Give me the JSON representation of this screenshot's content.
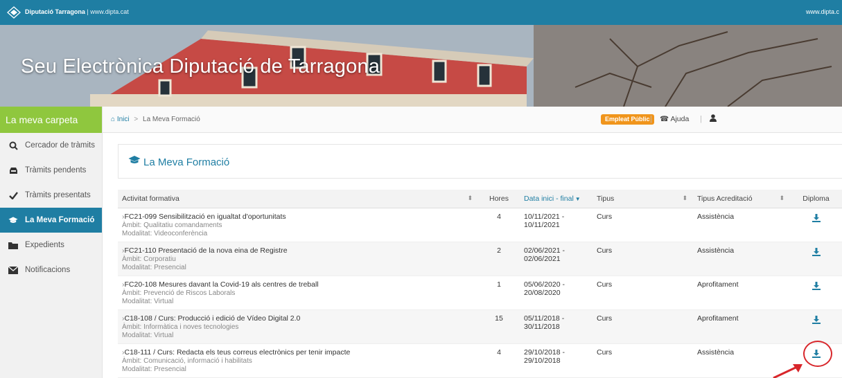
{
  "topbar": {
    "brand": "Diputació Tarragona",
    "brand_url": "| www.dipta.cat",
    "right_url": "www.dipta.c"
  },
  "banner": {
    "title": "Seu Electrònica Diputació de Tarragona"
  },
  "sidebar": {
    "heading": "La meva carpeta",
    "items": [
      {
        "label": "Cercador de tràmits",
        "icon": "search-icon"
      },
      {
        "label": "Tràmits pendents",
        "icon": "inbox-icon"
      },
      {
        "label": "Tràmits presentats",
        "icon": "check-icon"
      },
      {
        "label": "La Meva Formació",
        "icon": "graduation-cap-icon",
        "active": true
      },
      {
        "label": "Expedients",
        "icon": "folder-icon"
      },
      {
        "label": "Notificacions",
        "icon": "envelope-icon"
      }
    ]
  },
  "breadcrumb": {
    "home": "Inici",
    "separator": ">",
    "current": "La Meva Formació"
  },
  "header_actions": {
    "badge": "Empleat Públic",
    "help": "Ajuda"
  },
  "page": {
    "title": "La Meva Formació"
  },
  "table": {
    "columns": [
      "Activitat formativa",
      "Hores",
      "Data inici - final",
      "Tipus",
      "Tipus Acreditació",
      "Diploma"
    ],
    "rows": [
      {
        "title": "FC21-099 Sensibilització en igualtat d'oportunitats",
        "ambit": "Àmbit: Qualitatiu comandaments",
        "modalitat": "Modalitat: Videoconferència",
        "hores": "4",
        "dates": "10/11/2021 - 10/11/2021",
        "tipus": "Curs",
        "acreditacio": "Assistència"
      },
      {
        "title": "FC21-110 Presentació de la nova eina de Registre",
        "ambit": "Àmbit: Corporatiu",
        "modalitat": "Modalitat: Presencial",
        "hores": "2",
        "dates": "02/06/2021 - 02/06/2021",
        "tipus": "Curs",
        "acreditacio": "Assistència"
      },
      {
        "title": "FC20-108 Mesures davant la Covid-19 als centres de treball",
        "ambit": "Àmbit: Prevenció de Riscos Laborals",
        "modalitat": "Modalitat: Virtual",
        "hores": "1",
        "dates": "05/06/2020 - 20/08/2020",
        "tipus": "Curs",
        "acreditacio": "Aprofitament"
      },
      {
        "title": "C18-108 / Curs: Producció i edició de Vídeo Digital 2.0",
        "ambit": "Àmbit: Informàtica i noves tecnologies",
        "modalitat": "Modalitat: Virtual",
        "hores": "15",
        "dates": "05/11/2018 - 30/11/2018",
        "tipus": "Curs",
        "acreditacio": "Aprofitament"
      },
      {
        "title": "C18-111 / Curs: Redacta els teus correus electrònics per tenir impacte",
        "ambit": "Àmbit: Comunicació, informació i habilitats",
        "modalitat": "Modalitat: Presencial",
        "hores": "4",
        "dates": "29/10/2018 - 29/10/2018",
        "tipus": "Curs",
        "acreditacio": "Assistència"
      }
    ]
  },
  "colors": {
    "primary": "#1f7ea3",
    "sidebar_head": "#8fc73e",
    "badge": "#f0951c",
    "callout": "#d8262b"
  }
}
